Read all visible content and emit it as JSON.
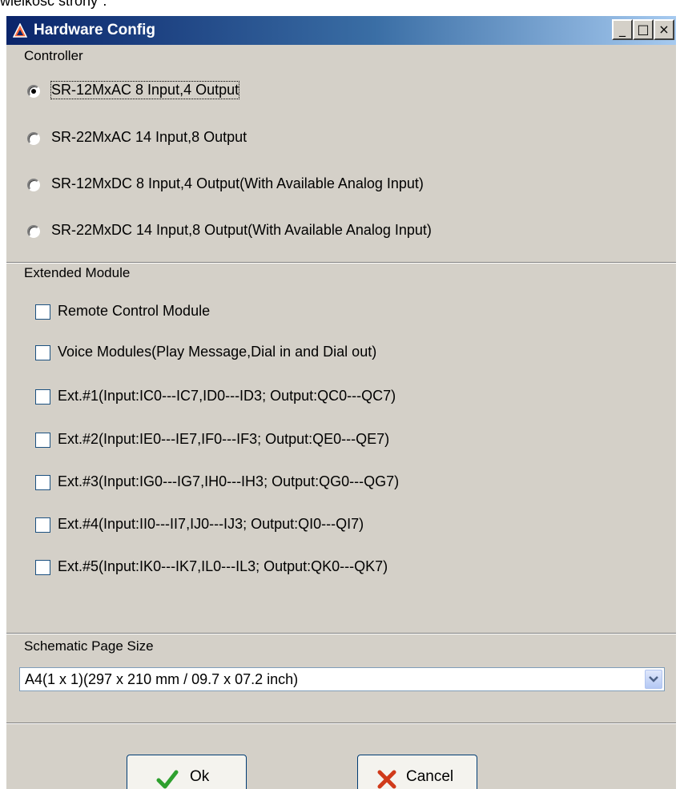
{
  "page_top_text": "wielkość strony\".",
  "window": {
    "title": "Hardware Config",
    "minimize": "_",
    "maximize": "□",
    "close": "×"
  },
  "controller": {
    "label": "Controller",
    "options": [
      {
        "label": "SR-12MxAC 8 Input,4 Output",
        "selected": true
      },
      {
        "label": "SR-22MxAC 14 Input,8 Output",
        "selected": false
      },
      {
        "label": "SR-12MxDC 8 Input,4 Output(With Available Analog Input)",
        "selected": false
      },
      {
        "label": "SR-22MxDC 14 Input,8 Output(With Available Analog Input)",
        "selected": false
      }
    ]
  },
  "extended": {
    "label": "Extended Module",
    "items": [
      {
        "label": "Remote Control Module",
        "checked": false
      },
      {
        "label": "Voice Modules(Play Message,Dial in and Dial out)",
        "checked": false
      },
      {
        "label": "Ext.#1(Input:IC0---IC7,ID0---ID3; Output:QC0---QC7)",
        "checked": false
      },
      {
        "label": "Ext.#2(Input:IE0---IE7,IF0---IF3; Output:QE0---QE7)",
        "checked": false
      },
      {
        "label": "Ext.#3(Input:IG0---IG7,IH0---IH3; Output:QG0---QG7)",
        "checked": false
      },
      {
        "label": "Ext.#4(Input:II0---II7,IJ0---IJ3; Output:QI0---QI7)",
        "checked": false
      },
      {
        "label": "Ext.#5(Input:IK0---IK7,IL0---IL3; Output:QK0---QK7)",
        "checked": false
      }
    ]
  },
  "page_size": {
    "label": "Schematic Page Size",
    "value": "A4(1 x 1)(297 x 210 mm / 09.7 x 07.2 inch)"
  },
  "buttons": {
    "ok": "Ok",
    "cancel": "Cancel"
  },
  "colors": {
    "title_bar_start": "#0a246a",
    "title_bar_end": "#a6caf0",
    "dialog_bg": "#d4d0c8",
    "ok_icon": "#2ea02e",
    "cancel_icon": "#d03a1a"
  },
  "icons": {
    "app": "app-logo-icon",
    "ok": "checkmark-icon",
    "cancel": "x-icon",
    "dropdown": "chevron-down-icon"
  }
}
